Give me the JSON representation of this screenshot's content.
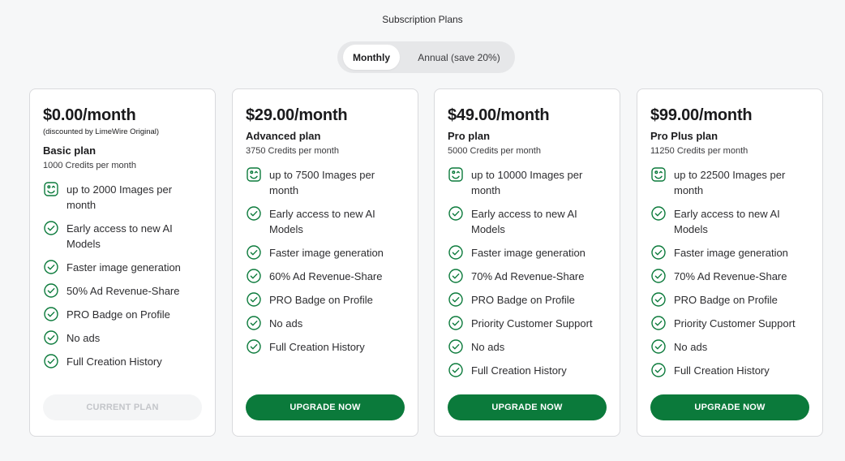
{
  "header": {
    "title": "Subscription Plans"
  },
  "billing_toggle": {
    "options": [
      "Monthly",
      "Annual (save 20%)"
    ],
    "selected": "Monthly"
  },
  "icons": {
    "first_feature": "image-icon",
    "other_features": "check-circle-icon"
  },
  "colors": {
    "accent": "#0b7a3b",
    "disabled_bg": "#f4f5f6",
    "disabled_text": "#c3c5c9"
  },
  "plans": [
    {
      "price": "$0.00/month",
      "discount_note": "(discounted by LimeWire Original)",
      "name": "Basic plan",
      "credits": "1000 Credits per month",
      "features": [
        "up to 2000 Images per month",
        "Early access to new AI Models",
        "Faster image generation",
        "50% Ad Revenue-Share",
        "PRO Badge on Profile",
        "No ads",
        "Full Creation History"
      ],
      "cta": "CURRENT PLAN"
    },
    {
      "price": "$29.00/month",
      "name": "Advanced plan",
      "credits": "3750 Credits per month",
      "features": [
        "up to 7500 Images per month",
        "Early access to new AI Models",
        "Faster image generation",
        "60% Ad Revenue-Share",
        "PRO Badge on Profile",
        "No ads",
        "Full Creation History"
      ],
      "cta": "UPGRADE NOW"
    },
    {
      "price": "$49.00/month",
      "name": "Pro plan",
      "credits": "5000 Credits per month",
      "features": [
        "up to 10000 Images per month",
        "Early access to new AI Models",
        "Faster image generation",
        "70% Ad Revenue-Share",
        "PRO Badge on Profile",
        "Priority Customer Support",
        "No ads",
        "Full Creation History"
      ],
      "cta": "UPGRADE NOW"
    },
    {
      "price": "$99.00/month",
      "name": "Pro Plus plan",
      "credits": "11250 Credits per month",
      "features": [
        "up to 22500 Images per month",
        "Early access to new AI Models",
        "Faster image generation",
        "70% Ad Revenue-Share",
        "PRO Badge on Profile",
        "Priority Customer Support",
        "No ads",
        "Full Creation History"
      ],
      "cta": "UPGRADE NOW"
    }
  ]
}
